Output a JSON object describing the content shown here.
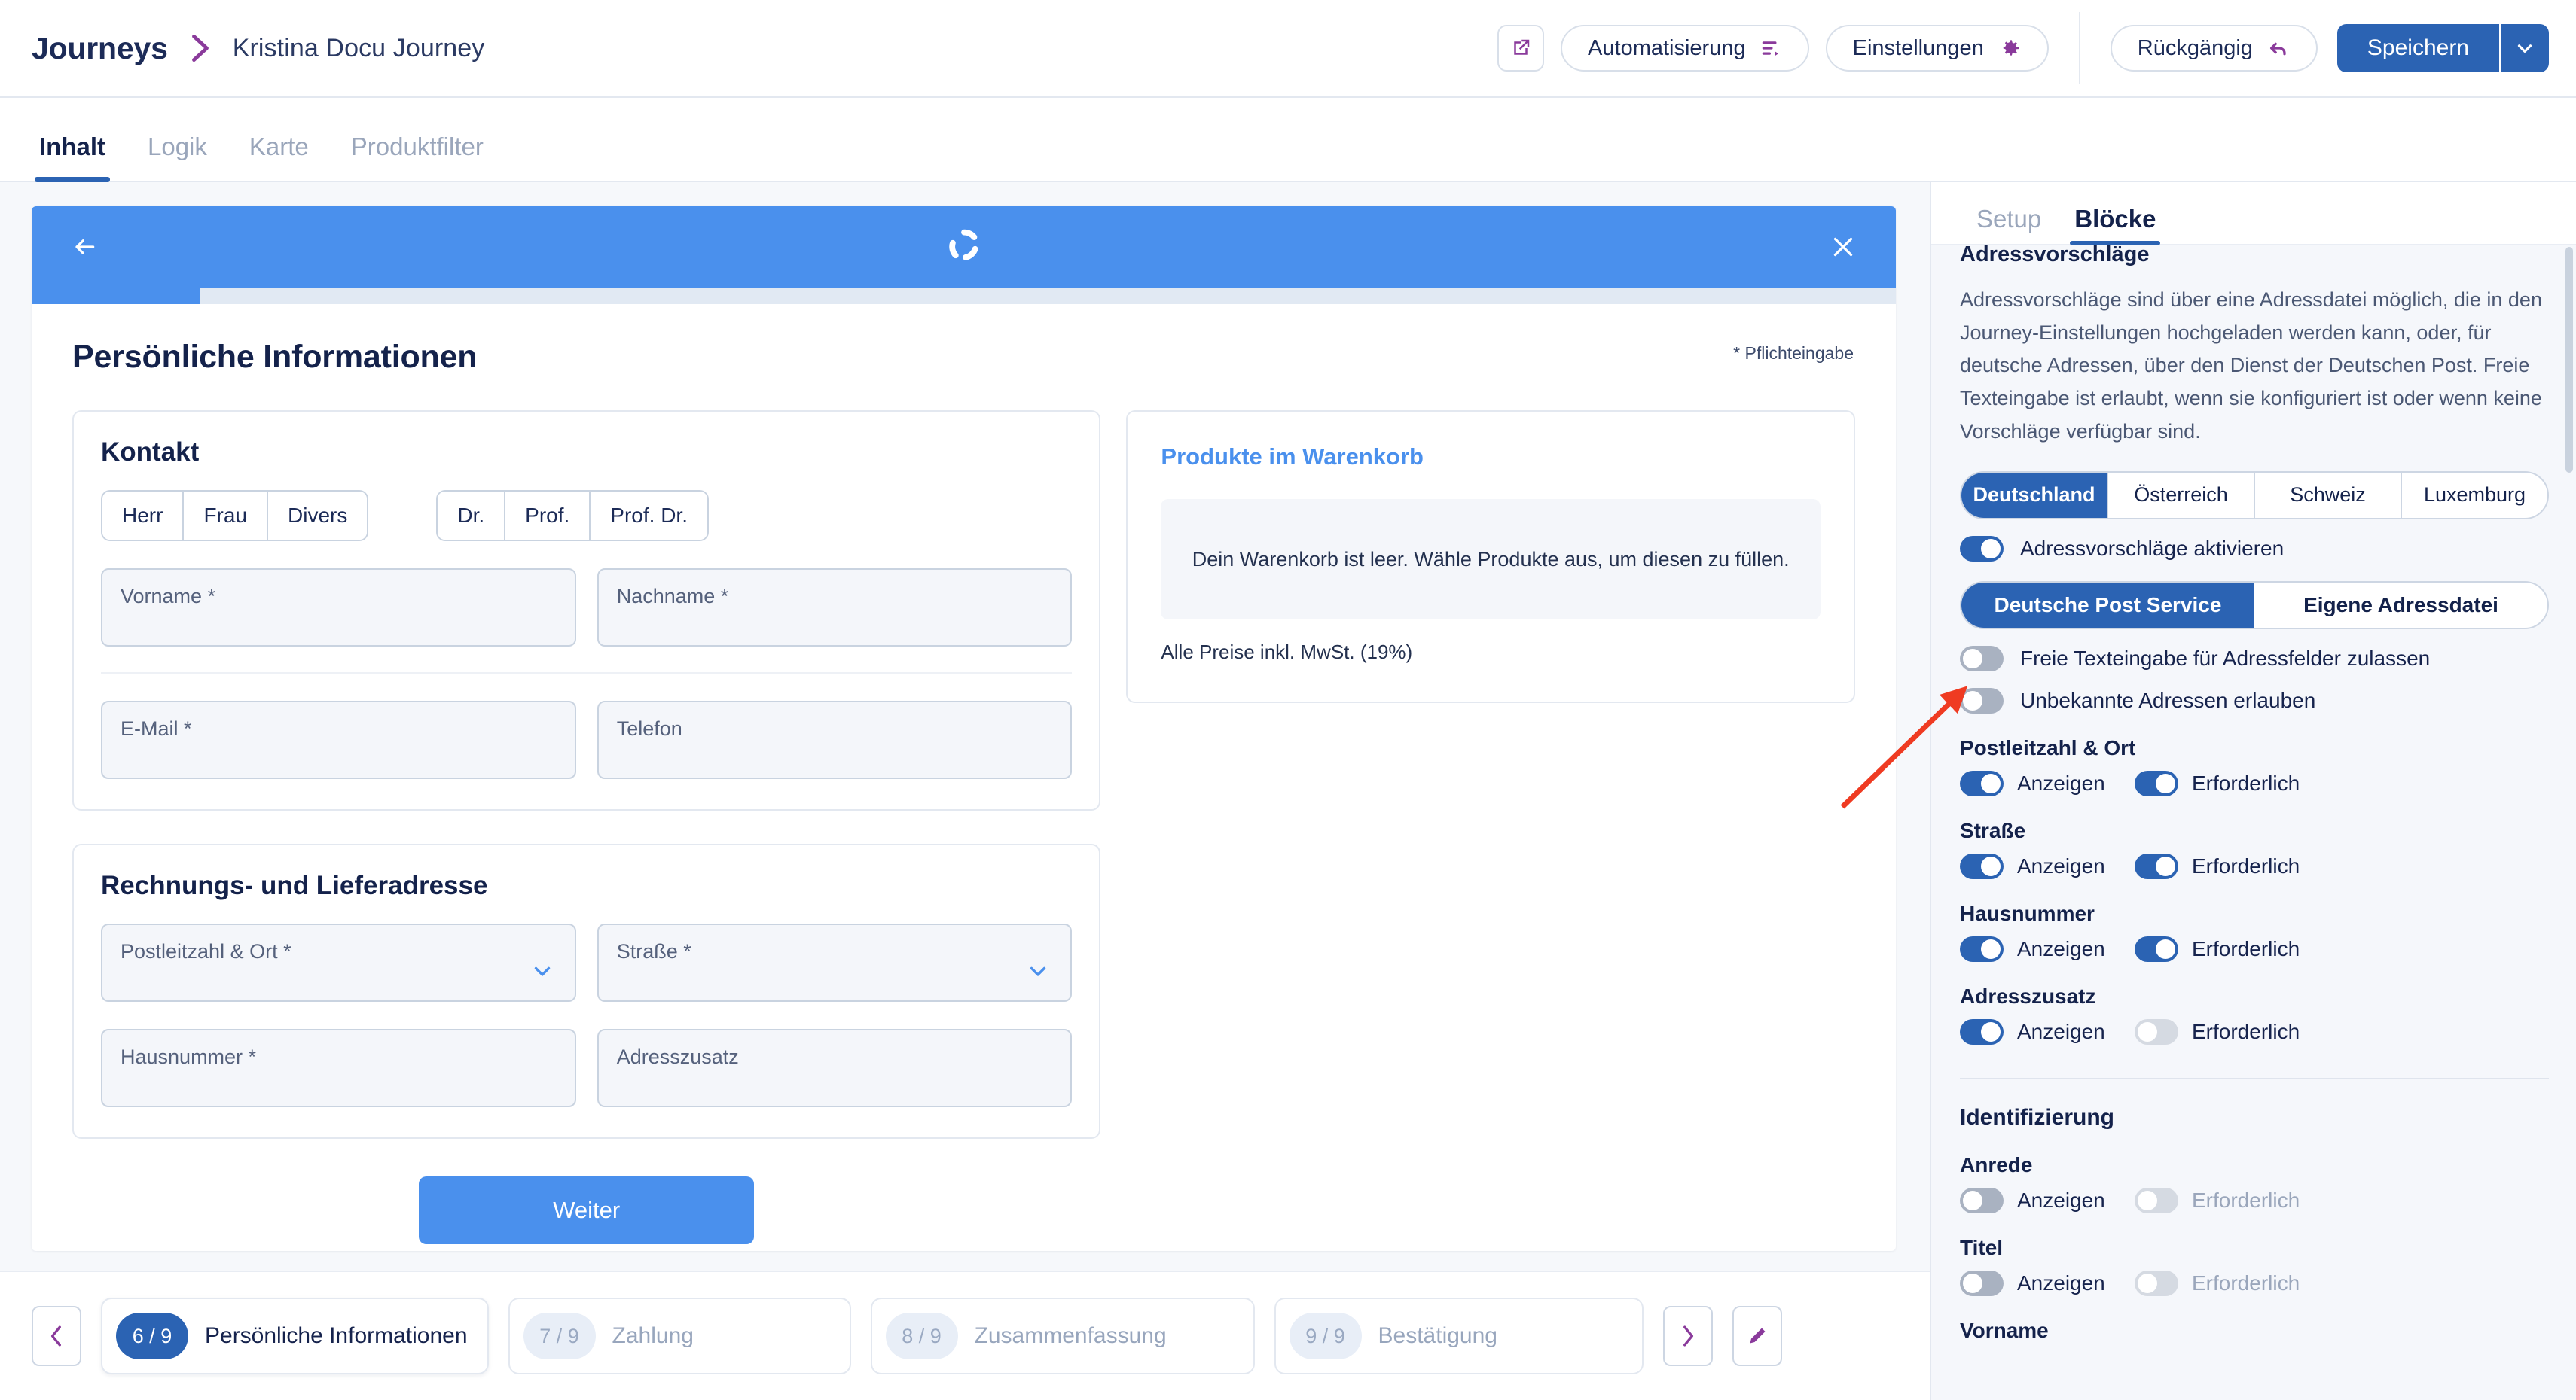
{
  "topbar": {
    "brand": "Journeys",
    "journey_name": "Kristina Docu Journey",
    "preview_icon": "external-link-icon",
    "automation_label": "Automatisierung",
    "automation_icon": "flow-list-icon",
    "settings_label": "Einstellungen",
    "settings_icon": "gear-icon",
    "undo_label": "Rückgängig",
    "undo_icon": "undo-arrow-icon",
    "save_label": "Speichern",
    "save_caret_icon": "chevron-down-icon",
    "accent_purple": "#8a3a9b",
    "accent_blue": "#2b63b3"
  },
  "tabs": [
    {
      "label": "Inhalt",
      "active": true
    },
    {
      "label": "Logik",
      "active": false
    },
    {
      "label": "Karte",
      "active": false
    },
    {
      "label": "Produktfilter",
      "active": false
    }
  ],
  "preview": {
    "header": {
      "back_icon": "arrow-left-icon",
      "spinner_icon": "loading-spinner-icon",
      "close_icon": "close-x-icon",
      "bar_color": "#4a90ed"
    },
    "progress_percent": 9,
    "title": "Persönliche Informationen",
    "required_note": "* Pflichteingabe",
    "contact": {
      "title": "Kontakt",
      "salutations": [
        "Herr",
        "Frau",
        "Divers"
      ],
      "titles": [
        "Dr.",
        "Prof.",
        "Prof. Dr."
      ],
      "fields": [
        {
          "label": "Vorname *"
        },
        {
          "label": "Nachname *"
        },
        {
          "label": "E-Mail *"
        },
        {
          "label": "Telefon"
        }
      ]
    },
    "address": {
      "title": "Rechnungs- und Lieferadresse",
      "fields": [
        {
          "label": "Postleitzahl & Ort *",
          "dropdown": true
        },
        {
          "label": "Straße *",
          "dropdown": true
        },
        {
          "label": "Hausnummer *",
          "dropdown": false
        },
        {
          "label": "Adresszusatz",
          "dropdown": false
        }
      ]
    },
    "cart": {
      "title": "Produkte im Warenkorb",
      "empty_text": "Dein Warenkorb ist leer. Wähle Produkte aus, um diesen zu füllen.",
      "tax_note": "Alle Preise inkl. MwSt. (19%)"
    },
    "submit_label": "Weiter"
  },
  "stepbar": {
    "prev_icon": "chevron-left-icon",
    "next_icon": "chevron-right-icon",
    "edit_icon": "pencil-icon",
    "steps": [
      {
        "counter": "6 / 9",
        "label": "Persönliche Informationen",
        "active": true
      },
      {
        "counter": "7 / 9",
        "label": "Zahlung",
        "active": false
      },
      {
        "counter": "8 / 9",
        "label": "Zusammenfassung",
        "active": false
      },
      {
        "counter": "9 / 9",
        "label": "Bestätigung",
        "active": false
      }
    ]
  },
  "sidebar": {
    "tabs": [
      {
        "label": "Setup",
        "active": false
      },
      {
        "label": "Blöcke",
        "active": true
      }
    ],
    "section_title": "Adressvorschläge",
    "description": "Adressvorschläge sind über eine Adressdatei möglich, die in den Journey-Einstellungen hochgeladen werden kann, oder, für deutsche Adressen, über den Dienst der Deutschen Post. Freie Texteingabe ist erlaubt, wenn sie konfiguriert ist oder wenn keine Vorschläge verfügbar sind.",
    "countries": [
      {
        "label": "Deutschland",
        "selected": true
      },
      {
        "label": "Österreich",
        "selected": false
      },
      {
        "label": "Schweiz",
        "selected": false
      },
      {
        "label": "Luxemburg",
        "selected": false
      }
    ],
    "enable_suggestions": {
      "label": "Adressvorschläge aktivieren",
      "on": true
    },
    "services": [
      {
        "label": "Deutsche Post Service",
        "selected": true
      },
      {
        "label": "Eigene Adressdatei",
        "selected": false
      }
    ],
    "free_text": {
      "label": "Freie Texteingabe für Adressfelder zulassen",
      "on": false
    },
    "unknown_addresses": {
      "label": "Unbekannte Adressen erlauben",
      "on": false
    },
    "toggle_labels": {
      "show": "Anzeigen",
      "required": "Erforderlich"
    },
    "address_fields": [
      {
        "name": "Postleitzahl & Ort",
        "show": true,
        "required": true,
        "required_dim": false
      },
      {
        "name": "Straße",
        "show": true,
        "required": true,
        "required_dim": false
      },
      {
        "name": "Hausnummer",
        "show": true,
        "required": true,
        "required_dim": false
      },
      {
        "name": "Adresszusatz",
        "show": true,
        "required": false,
        "required_dim": false
      }
    ],
    "identification_title": "Identifizierung",
    "identification_fields": [
      {
        "name": "Anrede",
        "show": false,
        "required": false,
        "required_dim": true
      },
      {
        "name": "Titel",
        "show": false,
        "required": false,
        "required_dim": true
      },
      {
        "name": "Vorname",
        "show": null,
        "required": null,
        "required_dim": true
      }
    ]
  },
  "annotation": {
    "arrow_color": "#ef3b22",
    "points_to": "unknown-addresses-toggle"
  }
}
